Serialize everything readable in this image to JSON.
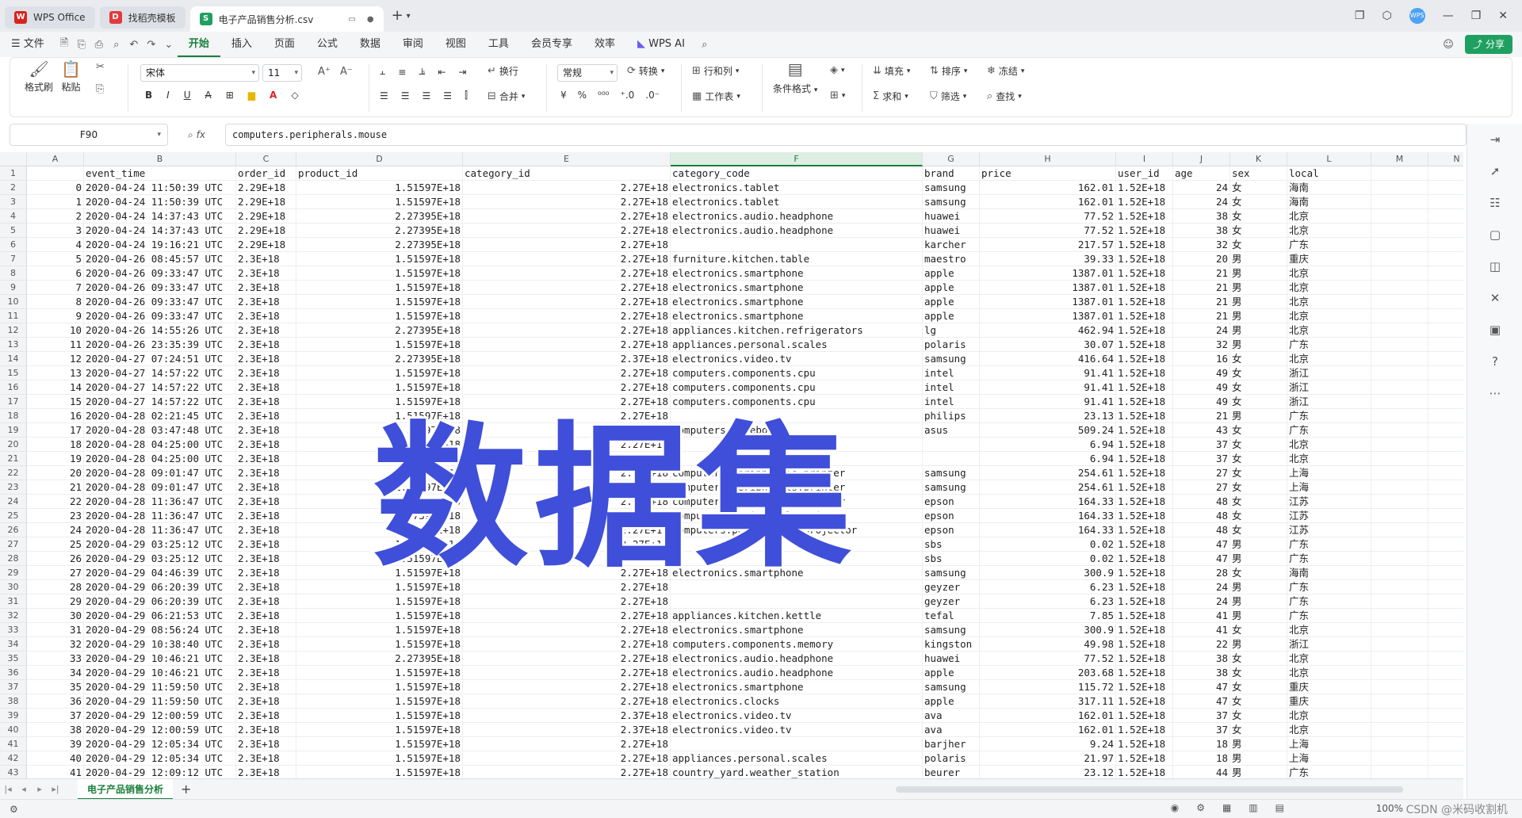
{
  "titlebar": {
    "tabs": [
      {
        "label": "WPS Office",
        "logo": "W",
        "color": "#d8241d",
        "state": "inactive"
      },
      {
        "label": "找稻壳模板",
        "logo": "D",
        "color": "#e4393c",
        "state": "inactive"
      },
      {
        "label": "电子产品销售分析.csv",
        "logo": "S",
        "color": "#1fa061",
        "state": "active"
      }
    ],
    "avatar": "WPS"
  },
  "menubar": {
    "file": "文件",
    "items": [
      "开始",
      "插入",
      "页面",
      "公式",
      "数据",
      "审阅",
      "视图",
      "工具",
      "会员专享",
      "效率"
    ],
    "active": "开始",
    "wps_ai": "WPS AI",
    "share": "分享"
  },
  "ribbon": {
    "format_painter": "格式刷",
    "paste": "粘贴",
    "font_name": "宋体",
    "font_size": "11",
    "wrap": "换行",
    "number_format": "常规",
    "convert": "转换",
    "row_col": "行和列",
    "worksheet": "工作表",
    "merge": "合并",
    "cond_format": "条件格式",
    "fill": "填充",
    "sort": "排序",
    "freeze": "冻结",
    "sum": "求和",
    "filter": "筛选",
    "find": "查找"
  },
  "formula_bar": {
    "cell_ref": "F90",
    "fx": "fx",
    "formula": "computers.peripherals.mouse"
  },
  "grid": {
    "columns": [
      "A",
      "B",
      "C",
      "D",
      "E",
      "F",
      "G",
      "H",
      "I",
      "J",
      "K",
      "L",
      "M",
      "N"
    ],
    "selected_column": "F",
    "header_row": [
      "",
      "event_time",
      "order_id",
      "product_id",
      "category_id",
      "category_code",
      "brand",
      "price",
      "user_id",
      "age",
      "sex",
      "local"
    ],
    "rows": [
      [
        "0",
        "2020-04-24 11:50:39 UTC",
        "2.29E+18",
        "1.51597E+18",
        "2.27E+18",
        "electronics.tablet",
        "samsung",
        "162.01",
        "1.52E+18",
        "24",
        "女",
        "海南"
      ],
      [
        "1",
        "2020-04-24 11:50:39 UTC",
        "2.29E+18",
        "1.51597E+18",
        "2.27E+18",
        "electronics.tablet",
        "samsung",
        "162.01",
        "1.52E+18",
        "24",
        "女",
        "海南"
      ],
      [
        "2",
        "2020-04-24 14:37:43 UTC",
        "2.29E+18",
        "2.27395E+18",
        "2.27E+18",
        "electronics.audio.headphone",
        "huawei",
        "77.52",
        "1.52E+18",
        "38",
        "女",
        "北京"
      ],
      [
        "3",
        "2020-04-24 14:37:43 UTC",
        "2.29E+18",
        "2.27395E+18",
        "2.27E+18",
        "electronics.audio.headphone",
        "huawei",
        "77.52",
        "1.52E+18",
        "38",
        "女",
        "北京"
      ],
      [
        "4",
        "2020-04-24 19:16:21 UTC",
        "2.29E+18",
        "2.27395E+18",
        "2.27E+18",
        "",
        "karcher",
        "217.57",
        "1.52E+18",
        "32",
        "女",
        "广东"
      ],
      [
        "5",
        "2020-04-26 08:45:57 UTC",
        "2.3E+18",
        "1.51597E+18",
        "2.27E+18",
        "furniture.kitchen.table",
        "maestro",
        "39.33",
        "1.52E+18",
        "20",
        "男",
        "重庆"
      ],
      [
        "6",
        "2020-04-26 09:33:47 UTC",
        "2.3E+18",
        "1.51597E+18",
        "2.27E+18",
        "electronics.smartphone",
        "apple",
        "1387.01",
        "1.52E+18",
        "21",
        "男",
        "北京"
      ],
      [
        "7",
        "2020-04-26 09:33:47 UTC",
        "2.3E+18",
        "1.51597E+18",
        "2.27E+18",
        "electronics.smartphone",
        "apple",
        "1387.01",
        "1.52E+18",
        "21",
        "男",
        "北京"
      ],
      [
        "8",
        "2020-04-26 09:33:47 UTC",
        "2.3E+18",
        "1.51597E+18",
        "2.27E+18",
        "electronics.smartphone",
        "apple",
        "1387.01",
        "1.52E+18",
        "21",
        "男",
        "北京"
      ],
      [
        "9",
        "2020-04-26 09:33:47 UTC",
        "2.3E+18",
        "1.51597E+18",
        "2.27E+18",
        "electronics.smartphone",
        "apple",
        "1387.01",
        "1.52E+18",
        "21",
        "男",
        "北京"
      ],
      [
        "10",
        "2020-04-26 14:55:26 UTC",
        "2.3E+18",
        "2.27395E+18",
        "2.27E+18",
        "appliances.kitchen.refrigerators",
        "lg",
        "462.94",
        "1.52E+18",
        "24",
        "男",
        "北京"
      ],
      [
        "11",
        "2020-04-26 23:35:39 UTC",
        "2.3E+18",
        "1.51597E+18",
        "2.27E+18",
        "appliances.personal.scales",
        "polaris",
        "30.07",
        "1.52E+18",
        "32",
        "男",
        "广东"
      ],
      [
        "12",
        "2020-04-27 07:24:51 UTC",
        "2.3E+18",
        "2.27395E+18",
        "2.37E+18",
        "electronics.video.tv",
        "samsung",
        "416.64",
        "1.52E+18",
        "16",
        "女",
        "北京"
      ],
      [
        "13",
        "2020-04-27 14:57:22 UTC",
        "2.3E+18",
        "1.51597E+18",
        "2.27E+18",
        "computers.components.cpu",
        "intel",
        "91.41",
        "1.52E+18",
        "49",
        "女",
        "浙江"
      ],
      [
        "14",
        "2020-04-27 14:57:22 UTC",
        "2.3E+18",
        "1.51597E+18",
        "2.27E+18",
        "computers.components.cpu",
        "intel",
        "91.41",
        "1.52E+18",
        "49",
        "女",
        "浙江"
      ],
      [
        "15",
        "2020-04-27 14:57:22 UTC",
        "2.3E+18",
        "1.51597E+18",
        "2.27E+18",
        "computers.components.cpu",
        "intel",
        "91.41",
        "1.52E+18",
        "49",
        "女",
        "浙江"
      ],
      [
        "16",
        "2020-04-28 02:21:45 UTC",
        "2.3E+18",
        "1.51597E+18",
        "2.27E+18",
        "",
        "philips",
        "23.13",
        "1.52E+18",
        "21",
        "男",
        "广东"
      ],
      [
        "17",
        "2020-04-28 03:47:48 UTC",
        "2.3E+18",
        "1.51597E+18",
        "2.27E+18",
        "computers.notebook",
        "asus",
        "509.24",
        "1.52E+18",
        "43",
        "女",
        "广东"
      ],
      [
        "18",
        "2020-04-28 04:25:00 UTC",
        "2.3E+18",
        "1.51597E+18",
        "2.27E+18",
        "",
        "",
        "6.94",
        "1.52E+18",
        "37",
        "女",
        "北京"
      ],
      [
        "19",
        "2020-04-28 04:25:00 UTC",
        "2.3E+18",
        "1.51597E+18",
        "2.27E+18",
        "",
        "",
        "6.94",
        "1.52E+18",
        "37",
        "女",
        "北京"
      ],
      [
        "20",
        "2020-04-28 09:01:47 UTC",
        "2.3E+18",
        "1.51597E+18",
        "2.27E+18",
        "computers.peripherals.printer",
        "samsung",
        "254.61",
        "1.52E+18",
        "27",
        "女",
        "上海"
      ],
      [
        "21",
        "2020-04-28 09:01:47 UTC",
        "2.3E+18",
        "1.51597E+18",
        "2.27E+18",
        "computers.peripherals.printer",
        "samsung",
        "254.61",
        "1.52E+18",
        "27",
        "女",
        "上海"
      ],
      [
        "22",
        "2020-04-28 11:36:47 UTC",
        "2.3E+18",
        "2.27395E+18",
        "2.27E+18",
        "computers.peripherals.printer",
        "epson",
        "164.33",
        "1.52E+18",
        "48",
        "女",
        "江苏"
      ],
      [
        "23",
        "2020-04-28 11:36:47 UTC",
        "2.3E+18",
        "2.27395E+18",
        "2.27E+18",
        "computers.peripherals.printer",
        "epson",
        "164.33",
        "1.52E+18",
        "48",
        "女",
        "江苏"
      ],
      [
        "24",
        "2020-04-28 11:36:47 UTC",
        "2.3E+18",
        "2.27395E+18",
        "2.27E+18",
        "computers.peripherals.projector",
        "epson",
        "164.33",
        "1.52E+18",
        "48",
        "女",
        "江苏"
      ],
      [
        "25",
        "2020-04-29 03:25:12 UTC",
        "2.3E+18",
        "1.51597E+18",
        "2.27E+18",
        "",
        "sbs",
        "0.02",
        "1.52E+18",
        "47",
        "男",
        "广东"
      ],
      [
        "26",
        "2020-04-29 03:25:12 UTC",
        "2.3E+18",
        "1.51597E+18",
        "2.27E+18",
        "",
        "sbs",
        "0.02",
        "1.52E+18",
        "47",
        "男",
        "广东"
      ],
      [
        "27",
        "2020-04-29 04:46:39 UTC",
        "2.3E+18",
        "1.51597E+18",
        "2.27E+18",
        "electronics.smartphone",
        "samsung",
        "300.9",
        "1.52E+18",
        "28",
        "女",
        "海南"
      ],
      [
        "28",
        "2020-04-29 06:20:39 UTC",
        "2.3E+18",
        "1.51597E+18",
        "2.27E+18",
        "",
        "geyzer",
        "6.23",
        "1.52E+18",
        "24",
        "男",
        "广东"
      ],
      [
        "29",
        "2020-04-29 06:20:39 UTC",
        "2.3E+18",
        "1.51597E+18",
        "2.27E+18",
        "",
        "geyzer",
        "6.23",
        "1.52E+18",
        "24",
        "男",
        "广东"
      ],
      [
        "30",
        "2020-04-29 06:21:53 UTC",
        "2.3E+18",
        "1.51597E+18",
        "2.27E+18",
        "appliances.kitchen.kettle",
        "tefal",
        "7.85",
        "1.52E+18",
        "41",
        "男",
        "广东"
      ],
      [
        "31",
        "2020-04-29 08:56:24 UTC",
        "2.3E+18",
        "1.51597E+18",
        "2.27E+18",
        "electronics.smartphone",
        "samsung",
        "300.9",
        "1.52E+18",
        "41",
        "女",
        "北京"
      ],
      [
        "32",
        "2020-04-29 10:38:40 UTC",
        "2.3E+18",
        "1.51597E+18",
        "2.27E+18",
        "computers.components.memory",
        "kingston",
        "49.98",
        "1.52E+18",
        "22",
        "男",
        "浙江"
      ],
      [
        "33",
        "2020-04-29 10:46:21 UTC",
        "2.3E+18",
        "2.27395E+18",
        "2.27E+18",
        "electronics.audio.headphone",
        "huawei",
        "77.52",
        "1.52E+18",
        "38",
        "女",
        "北京"
      ],
      [
        "34",
        "2020-04-29 10:46:21 UTC",
        "2.3E+18",
        "1.51597E+18",
        "2.27E+18",
        "electronics.audio.headphone",
        "apple",
        "203.68",
        "1.52E+18",
        "38",
        "女",
        "北京"
      ],
      [
        "35",
        "2020-04-29 11:59:50 UTC",
        "2.3E+18",
        "1.51597E+18",
        "2.27E+18",
        "electronics.smartphone",
        "samsung",
        "115.72",
        "1.52E+18",
        "47",
        "女",
        "重庆"
      ],
      [
        "36",
        "2020-04-29 11:59:50 UTC",
        "2.3E+18",
        "1.51597E+18",
        "2.27E+18",
        "electronics.clocks",
        "apple",
        "317.11",
        "1.52E+18",
        "47",
        "女",
        "重庆"
      ],
      [
        "37",
        "2020-04-29 12:00:59 UTC",
        "2.3E+18",
        "1.51597E+18",
        "2.37E+18",
        "electronics.video.tv",
        "ava",
        "162.01",
        "1.52E+18",
        "37",
        "女",
        "北京"
      ],
      [
        "38",
        "2020-04-29 12:00:59 UTC",
        "2.3E+18",
        "1.51597E+18",
        "2.37E+18",
        "electronics.video.tv",
        "ava",
        "162.01",
        "1.52E+18",
        "37",
        "女",
        "北京"
      ],
      [
        "39",
        "2020-04-29 12:05:34 UTC",
        "2.3E+18",
        "1.51597E+18",
        "2.27E+18",
        "",
        "barjher",
        "9.24",
        "1.52E+18",
        "18",
        "男",
        "上海"
      ],
      [
        "40",
        "2020-04-29 12:05:34 UTC",
        "2.3E+18",
        "1.51597E+18",
        "2.27E+18",
        "appliances.personal.scales",
        "polaris",
        "21.97",
        "1.52E+18",
        "18",
        "男",
        "上海"
      ],
      [
        "41",
        "2020-04-29 12:09:12 UTC",
        "2.3E+18",
        "1.51597E+18",
        "2.27E+18",
        "country_yard.weather_station",
        "beurer",
        "23.12",
        "1.52E+18",
        "44",
        "男",
        "广东"
      ]
    ]
  },
  "watermark": "数据集",
  "sheetbar": {
    "sheet": "电子产品销售分析",
    "add": "+"
  },
  "statusbar": {
    "zoom": "100%",
    "credit": "CSDN @米码收割机"
  }
}
